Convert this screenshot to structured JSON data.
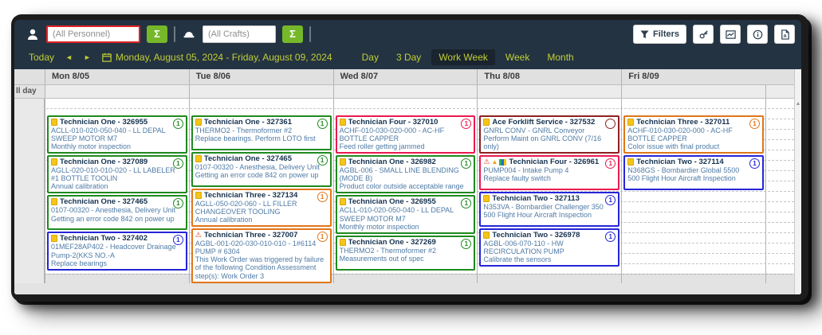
{
  "toolbar": {
    "personnel_placeholder": "(All Personnel)",
    "crafts_placeholder": "(All Crafts)",
    "sigma_label": "Σ",
    "filters_label": "Filters",
    "icons": [
      "person-icon",
      "hard-hat-icon",
      "funnel-icon",
      "key-icon",
      "chart-icon",
      "info-icon",
      "document-icon"
    ]
  },
  "datebar": {
    "today_label": "Today",
    "prev_arrow": "◄",
    "next_arrow": "►",
    "date_range": "Monday, August 05, 2024 - Friday, August 09, 2024",
    "views": [
      "Day",
      "3 Day",
      "Work Week",
      "Week",
      "Month"
    ],
    "selected_view": "Work Week"
  },
  "colors": {
    "toolbar_bg": "#233342",
    "accent_green": "#76b82a",
    "accent_yellow": "#c1ce35",
    "input_alert_border": "#e02424",
    "green": "#1f8a1f",
    "blue": "#2525d8",
    "orange": "#e0761a",
    "crimson": "#ea1a50",
    "maroon": "#8e2020"
  },
  "calendar": {
    "all_day_label": "ll day",
    "scroll_up_arrow": "▲",
    "days": [
      {
        "label": "Mon 8/05",
        "cards": [
          {
            "title": "Technician One - 326955",
            "asset": "ACLL-010-020-050-040 - LL DEPAL SWEEP MOTOR M7",
            "desc": "Monthly motor inspection",
            "color": "green",
            "badge": "1",
            "icons": [
              "assignment"
            ]
          },
          {
            "title": "Technician One - 327089",
            "asset": "AGLL-020-010-010-020 - LL LABELER #1 BOTTLE TOOLIN",
            "desc": "Annual calibration",
            "color": "green",
            "badge": "1",
            "icons": [
              "assignment"
            ]
          },
          {
            "title": "Technician One - 327465",
            "asset": "0107-00320 - Anesthesia, Delivery Unit",
            "desc": "Getting an error code 842 on power up",
            "color": "green",
            "badge": "1",
            "icons": [
              "assignment"
            ]
          },
          {
            "title": "Technician Two - 327402",
            "asset": "01MEF28AP402 - Headcover Drainage Pump-2(KKS NO.-A",
            "desc": "Replace bearings",
            "color": "blue",
            "badge": "1",
            "icons": [
              "assignment"
            ]
          }
        ]
      },
      {
        "label": "Tue 8/06",
        "cards": [
          {
            "title": "Technician One - 327361",
            "asset": "THERMO2 - Thermoformer #2",
            "desc": "Replace bearings. Perform LOTO first",
            "color": "green",
            "badge": "1",
            "icons": [
              "assignment"
            ]
          },
          {
            "title": "Technician One - 327465",
            "asset": "0107-00320 - Anesthesia, Delivery Unit",
            "desc": "Getting an error code 842 on power up",
            "color": "green",
            "badge": "1",
            "icons": [
              "assignment"
            ]
          },
          {
            "title": "Technician Three - 327134",
            "asset": "AGLL-050-020-060 - LL FILLER CHANGEOVER TOOLING",
            "desc": "Annual calibration",
            "color": "orange",
            "badge": "1",
            "icons": [
              "assignment"
            ]
          },
          {
            "title": "Technician Three - 327007",
            "asset": "AGBL-001-020-030-010-010 - 1#6114 PUMP # 6304",
            "desc": "This Work Order was triggered by failure of the following Condition Assessment step(s): Work Order 3",
            "color": "orange",
            "badge": "1",
            "icons": [
              "warning-triangle"
            ]
          }
        ]
      },
      {
        "label": "Wed 8/07",
        "cards": [
          {
            "title": "Technician Four - 327010",
            "asset": "ACHF-010-030-020-000 - AC-HF BOTTLE CAPPER",
            "desc": "Feed roller getting jammed",
            "color": "crimson",
            "badge": "1",
            "icons": [
              "assignment"
            ]
          },
          {
            "title": "Technician One - 326982",
            "asset": "AGBL-006 - SMALL LINE BLENDING (MODE B)",
            "desc": "Product color outside acceptable range",
            "color": "green",
            "badge": "1",
            "icons": [
              "assignment"
            ]
          },
          {
            "title": "Technician One - 326955",
            "asset": "ACLL-010-020-050-040 - LL DEPAL SWEEP MOTOR M7",
            "desc": "Monthly motor inspection",
            "color": "green",
            "badge": "1",
            "icons": [
              "assignment"
            ]
          },
          {
            "title": "Technician One - 327269",
            "asset": "THERMO2 - Thermoformer #2",
            "desc": "Measurements out of spec",
            "color": "green",
            "badge": "1",
            "icons": [
              "assignment"
            ]
          }
        ]
      },
      {
        "label": "Thu 8/08",
        "cards": [
          {
            "title": "Ace Forklift Service - 327532",
            "asset": "GNRL CONV - GNRL Conveyor",
            "desc": "Perform Maint on GNRL CONV (7/16 only)",
            "color": "maroon",
            "badge": "",
            "icons": [
              "assignment"
            ]
          },
          {
            "title": "Technician Four - 326961",
            "asset": "PUMP004 - Intake Pump 4",
            "desc": "Replace faulty switch",
            "color": "crimson",
            "badge": "1",
            "icons": [
              "warning-triangle",
              "orange-triangle",
              "mini-chart"
            ]
          },
          {
            "title": "Technician Two - 327113",
            "asset": "N353VA - Bombardier Challenger 350",
            "desc": "500 Flight Hour Aircraft Inspection",
            "color": "blue",
            "badge": "1",
            "icons": [
              "assignment"
            ]
          },
          {
            "title": "Technician Two - 326978",
            "asset": "AGBL-006-070-110 - HW RECIRCULATION PUMP",
            "desc": "Calibrate the sensors",
            "color": "blue",
            "badge": "1",
            "icons": [
              "assignment"
            ]
          }
        ]
      },
      {
        "label": "Fri 8/09",
        "cards": [
          {
            "title": "Technician Three - 327011",
            "asset": "ACHF-010-030-020-000 - AC-HF BOTTLE CAPPER",
            "desc": "Color issue with final product",
            "color": "orange",
            "badge": "1",
            "icons": [
              "assignment"
            ]
          },
          {
            "title": "Technician Two - 327114",
            "asset": "N368GS - Bombardier Global 5500",
            "desc": "500 Flight Hour Aircraft Inspection",
            "color": "blue",
            "badge": "1",
            "icons": [
              "assignment"
            ]
          }
        ]
      }
    ]
  }
}
